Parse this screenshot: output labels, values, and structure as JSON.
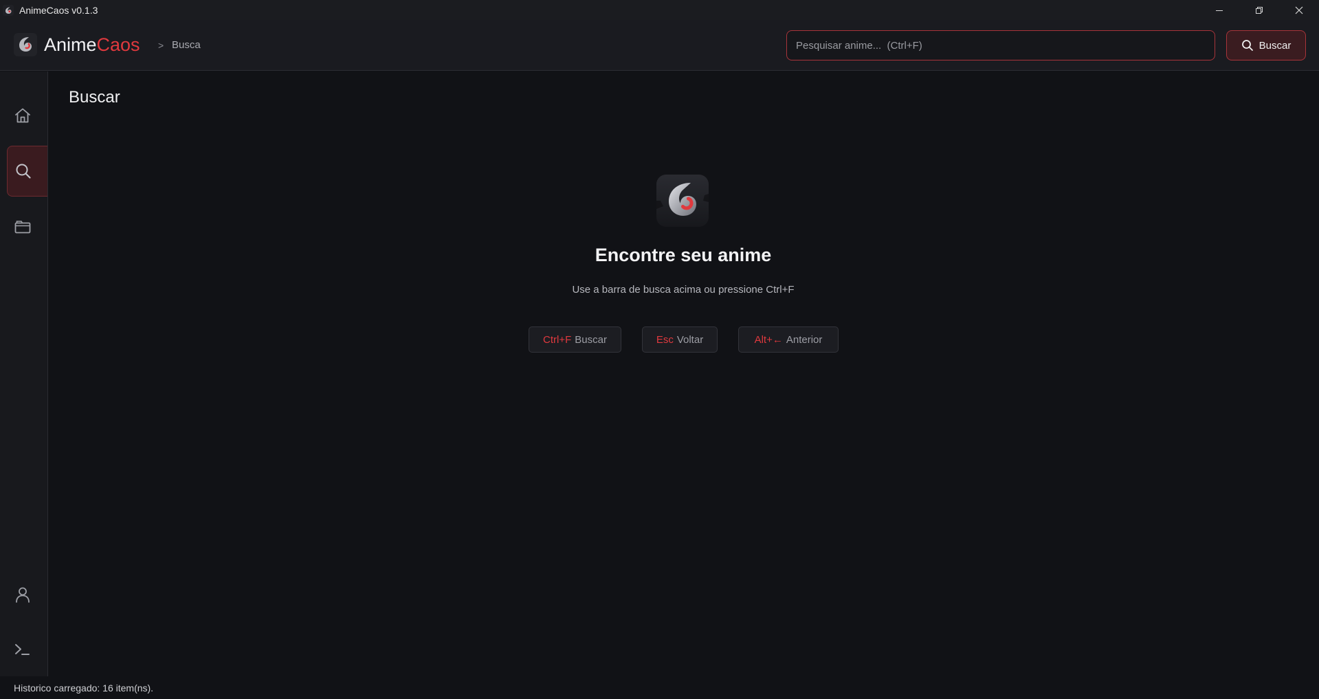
{
  "window": {
    "title": "AnimeCaos v0.1.3"
  },
  "header": {
    "brand_main": "Anime",
    "brand_accent": "Caos",
    "breadcrumb_sep": ">",
    "breadcrumb": "Busca",
    "search_placeholder": "Pesquisar anime...  (Ctrl+F)",
    "search_value": "",
    "search_button_label": "Buscar"
  },
  "sidebar": {
    "items": [
      {
        "name": "home",
        "icon": "home-icon",
        "active": false
      },
      {
        "name": "search",
        "icon": "search-icon",
        "active": true
      },
      {
        "name": "library",
        "icon": "folder-icon",
        "active": false
      },
      {
        "name": "profile",
        "icon": "user-icon",
        "active": false
      },
      {
        "name": "console",
        "icon": "terminal-icon",
        "active": false
      }
    ]
  },
  "main": {
    "title": "Buscar",
    "empty_title": "Encontre seu anime",
    "empty_subtitle": "Use a barra de busca acima ou pressione Ctrl+F",
    "shortcuts": [
      {
        "key": "Ctrl+F",
        "label": "Buscar"
      },
      {
        "key": "Esc",
        "label": "Voltar"
      },
      {
        "key": "Alt+←",
        "label": "Anterior"
      }
    ]
  },
  "status": {
    "text": "Historico carregado: 16 item(ns)."
  },
  "colors": {
    "accent": "#e0393e",
    "background": "#111216",
    "header": "#1a1b20",
    "active_nav": "#3a1b1f"
  }
}
